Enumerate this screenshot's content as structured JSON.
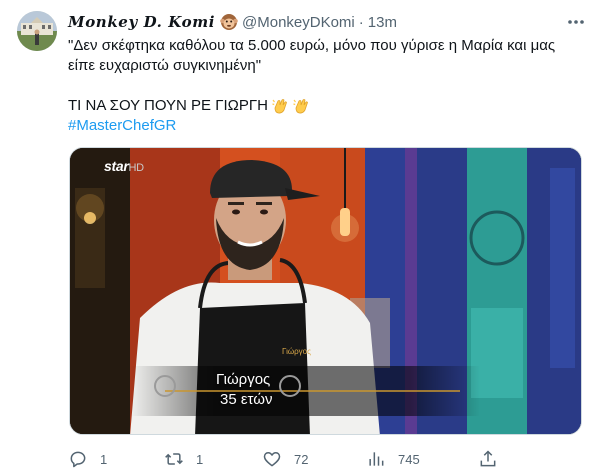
{
  "author": {
    "display_name": "Monkey D. Komi",
    "handle": "@MonkeyDKomi",
    "separator": "·",
    "time": "13m",
    "avatar_icon": "profile-avatar",
    "name_emoji_icon": "monkey-face-emoji"
  },
  "tweet": {
    "quote_line1": "\"Δεν σκέφτηκα καθόλου τα 5.000 ευρώ, μόνο που γύρισε η Μαρία και μας",
    "quote_line2": "είπε ευχαριστώ συγκινημένη\"",
    "shout": "ΤΙ ΝΑ ΣΟΥ ΠΟΥΝ ΡΕ ΓΙΩΡΓΗ",
    "shout_emoji_icon": "clapping-hands-emoji",
    "hashtag": "#MasterChefGR"
  },
  "media": {
    "channel_logo": "star",
    "channel_logo_suffix": "HD",
    "apron_label": "Γιώργος",
    "caption_name": "Γιώργος",
    "caption_age": "35 ετών"
  },
  "actions": {
    "reply_count": "1",
    "retweet_count": "1",
    "like_count": "72",
    "views_count": "745"
  },
  "colors": {
    "accent": "#1d9bf0",
    "secondary_text": "#536471",
    "primary_text": "#0f1419"
  }
}
